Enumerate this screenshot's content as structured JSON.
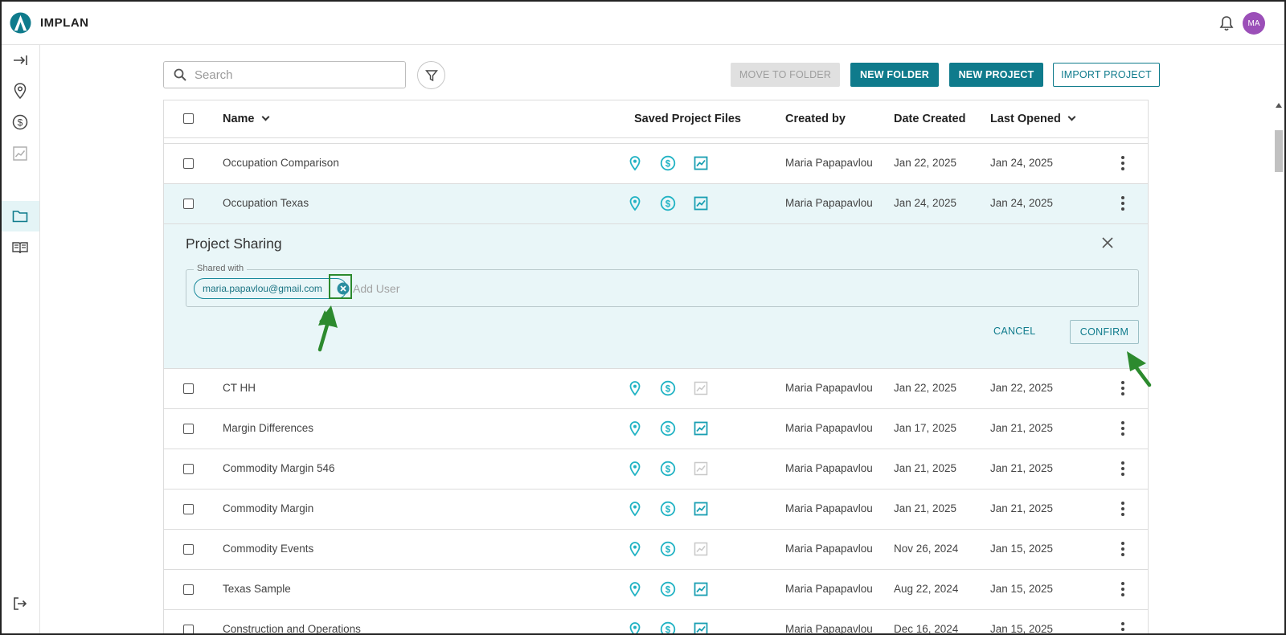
{
  "app": {
    "title": "IMPLAN",
    "user_initials": "MA",
    "avatar_color": "#9b4fb8",
    "accent_color": "#0f7b8c"
  },
  "rail": {
    "items": [
      {
        "icon": "expand-sidebar-icon"
      },
      {
        "icon": "location-pin-icon"
      },
      {
        "icon": "dollar-icon"
      },
      {
        "icon": "chart-icon"
      },
      {
        "icon": "folder-icon",
        "active": true
      },
      {
        "icon": "book-icon"
      },
      {
        "icon": "logout-icon"
      }
    ]
  },
  "toolbar": {
    "search_placeholder": "Search",
    "move_to_folder": "MOVE TO FOLDER",
    "new_folder": "NEW FOLDER",
    "new_project": "NEW PROJECT",
    "import_project": "IMPORT PROJECT"
  },
  "table": {
    "headers": {
      "name": "Name",
      "saved_files": "Saved Project Files",
      "created_by": "Created by",
      "date_created": "Date Created",
      "last_opened": "Last Opened"
    },
    "rows": [
      {
        "name": "Occupation Comparison",
        "created_by": "Maria Papapavlou",
        "date_created": "Jan 22, 2025",
        "last_opened": "Jan 24, 2025",
        "analysis_saved": true
      },
      {
        "name": "Occupation Texas",
        "created_by": "Maria Papapavlou",
        "date_created": "Jan 24, 2025",
        "last_opened": "Jan 24, 2025",
        "analysis_saved": true,
        "selected": true
      },
      {
        "name": "CT HH",
        "created_by": "Maria Papapavlou",
        "date_created": "Jan 22, 2025",
        "last_opened": "Jan 22, 2025",
        "analysis_saved": false
      },
      {
        "name": "Margin Differences",
        "created_by": "Maria Papapavlou",
        "date_created": "Jan 17, 2025",
        "last_opened": "Jan 21, 2025",
        "analysis_saved": true
      },
      {
        "name": "Commodity Margin 546",
        "created_by": "Maria Papapavlou",
        "date_created": "Jan 21, 2025",
        "last_opened": "Jan 21, 2025",
        "analysis_saved": false
      },
      {
        "name": "Commodity Margin",
        "created_by": "Maria Papapavlou",
        "date_created": "Jan 21, 2025",
        "last_opened": "Jan 21, 2025",
        "analysis_saved": true
      },
      {
        "name": "Commodity Events",
        "created_by": "Maria Papapavlou",
        "date_created": "Nov 26, 2024",
        "last_opened": "Jan 15, 2025",
        "analysis_saved": false
      },
      {
        "name": "Texas Sample",
        "created_by": "Maria Papapavlou",
        "date_created": "Aug 22, 2024",
        "last_opened": "Jan 15, 2025",
        "analysis_saved": true
      },
      {
        "name": "Construction and Operations",
        "created_by": "Maria Papapavlou",
        "date_created": "Dec 16, 2024",
        "last_opened": "Jan 15, 2025",
        "analysis_saved": true
      }
    ]
  },
  "sharing": {
    "title": "Project Sharing",
    "field_label": "Shared with",
    "chip_email": "maria.papavlou@gmail.com",
    "add_user_placeholder": "Add User",
    "cancel": "CANCEL",
    "confirm": "CONFIRM"
  }
}
